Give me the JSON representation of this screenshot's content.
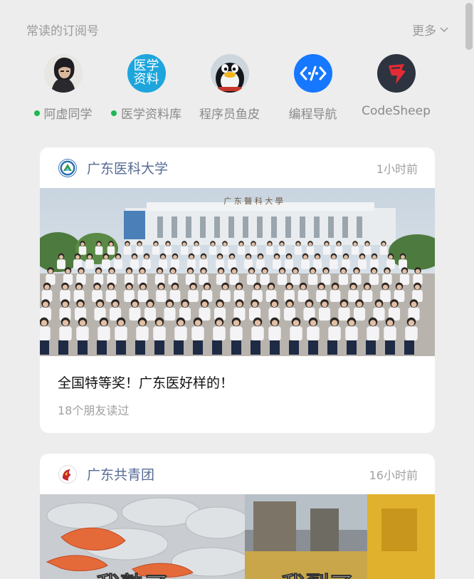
{
  "section": {
    "title": "常读的订阅号",
    "more_label": "更多"
  },
  "subscriptions": [
    {
      "name": "阿虚同学",
      "has_update": true,
      "avatar": "anime-character-avatar"
    },
    {
      "name": "医学资料库",
      "has_update": true,
      "avatar": "medical-library-avatar",
      "avatar_text_1": "医学",
      "avatar_text_2": "资料"
    },
    {
      "name": "程序员鱼皮",
      "has_update": false,
      "avatar": "penguin-avatar"
    },
    {
      "name": "编程导航",
      "has_update": false,
      "avatar": "code-nav-avatar"
    },
    {
      "name": "CodeSheep",
      "has_update": false,
      "avatar": "codesheep-avatar"
    }
  ],
  "articles": [
    {
      "source": "广东医科大学",
      "time": "1小时前",
      "banner_text": "广 东 醫 科 大 學",
      "title": "全国特等奖！广东医好样的！",
      "readers": "18个朋友读过"
    },
    {
      "source": "广东共青团",
      "time": "16小时前",
      "caption_left": "我熟了",
      "caption_right": "我裂了"
    }
  ],
  "colors": {
    "background": "#ededed",
    "source_name": "#576b95",
    "update_dot": "#1db954",
    "muted_text": "#a0a0a0"
  }
}
